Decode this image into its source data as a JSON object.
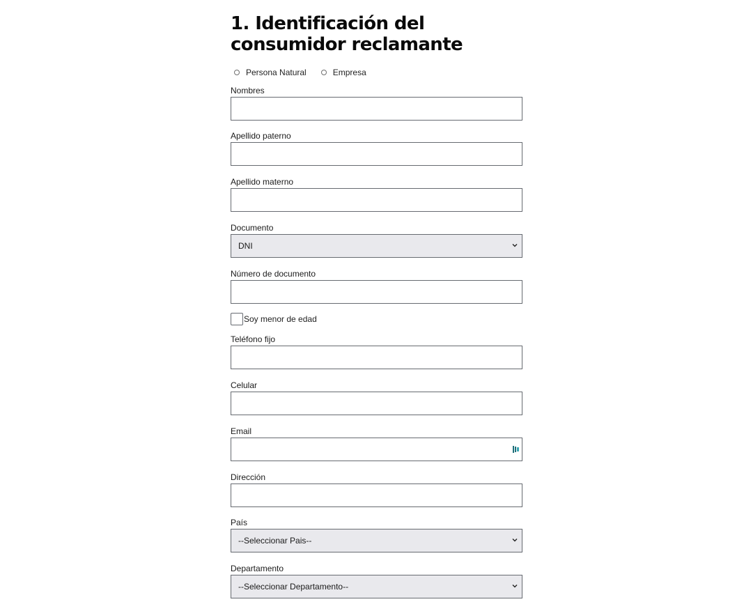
{
  "form": {
    "title": "1. Identificación del consumidor reclamante",
    "radio_options": [
      "Persona Natural",
      "Empresa"
    ],
    "fields": {
      "nombres": "Nombres",
      "apellido_paterno": "Apellido paterno",
      "apellido_materno": "Apellido materno",
      "documento": "Documento",
      "documento_value": "DNI",
      "numero_documento": "Número de documento",
      "menor_edad": "Soy menor de edad",
      "telefono_fijo": "Teléfono fijo",
      "celular": "Celular",
      "email": "Email",
      "direccion": "Dirección",
      "pais": "País",
      "pais_value": "--Seleccionar Pais--",
      "departamento": "Departamento",
      "departamento_value": "--Seleccionar Departamento--"
    },
    "icons": {
      "select_arrow": "chevron-down-icon",
      "email_field_icon": "password-manager-icon"
    },
    "colors": {
      "input_border": "#666a70",
      "select_background": "#e9e9ed",
      "title_text": "#0a0a0a"
    }
  }
}
